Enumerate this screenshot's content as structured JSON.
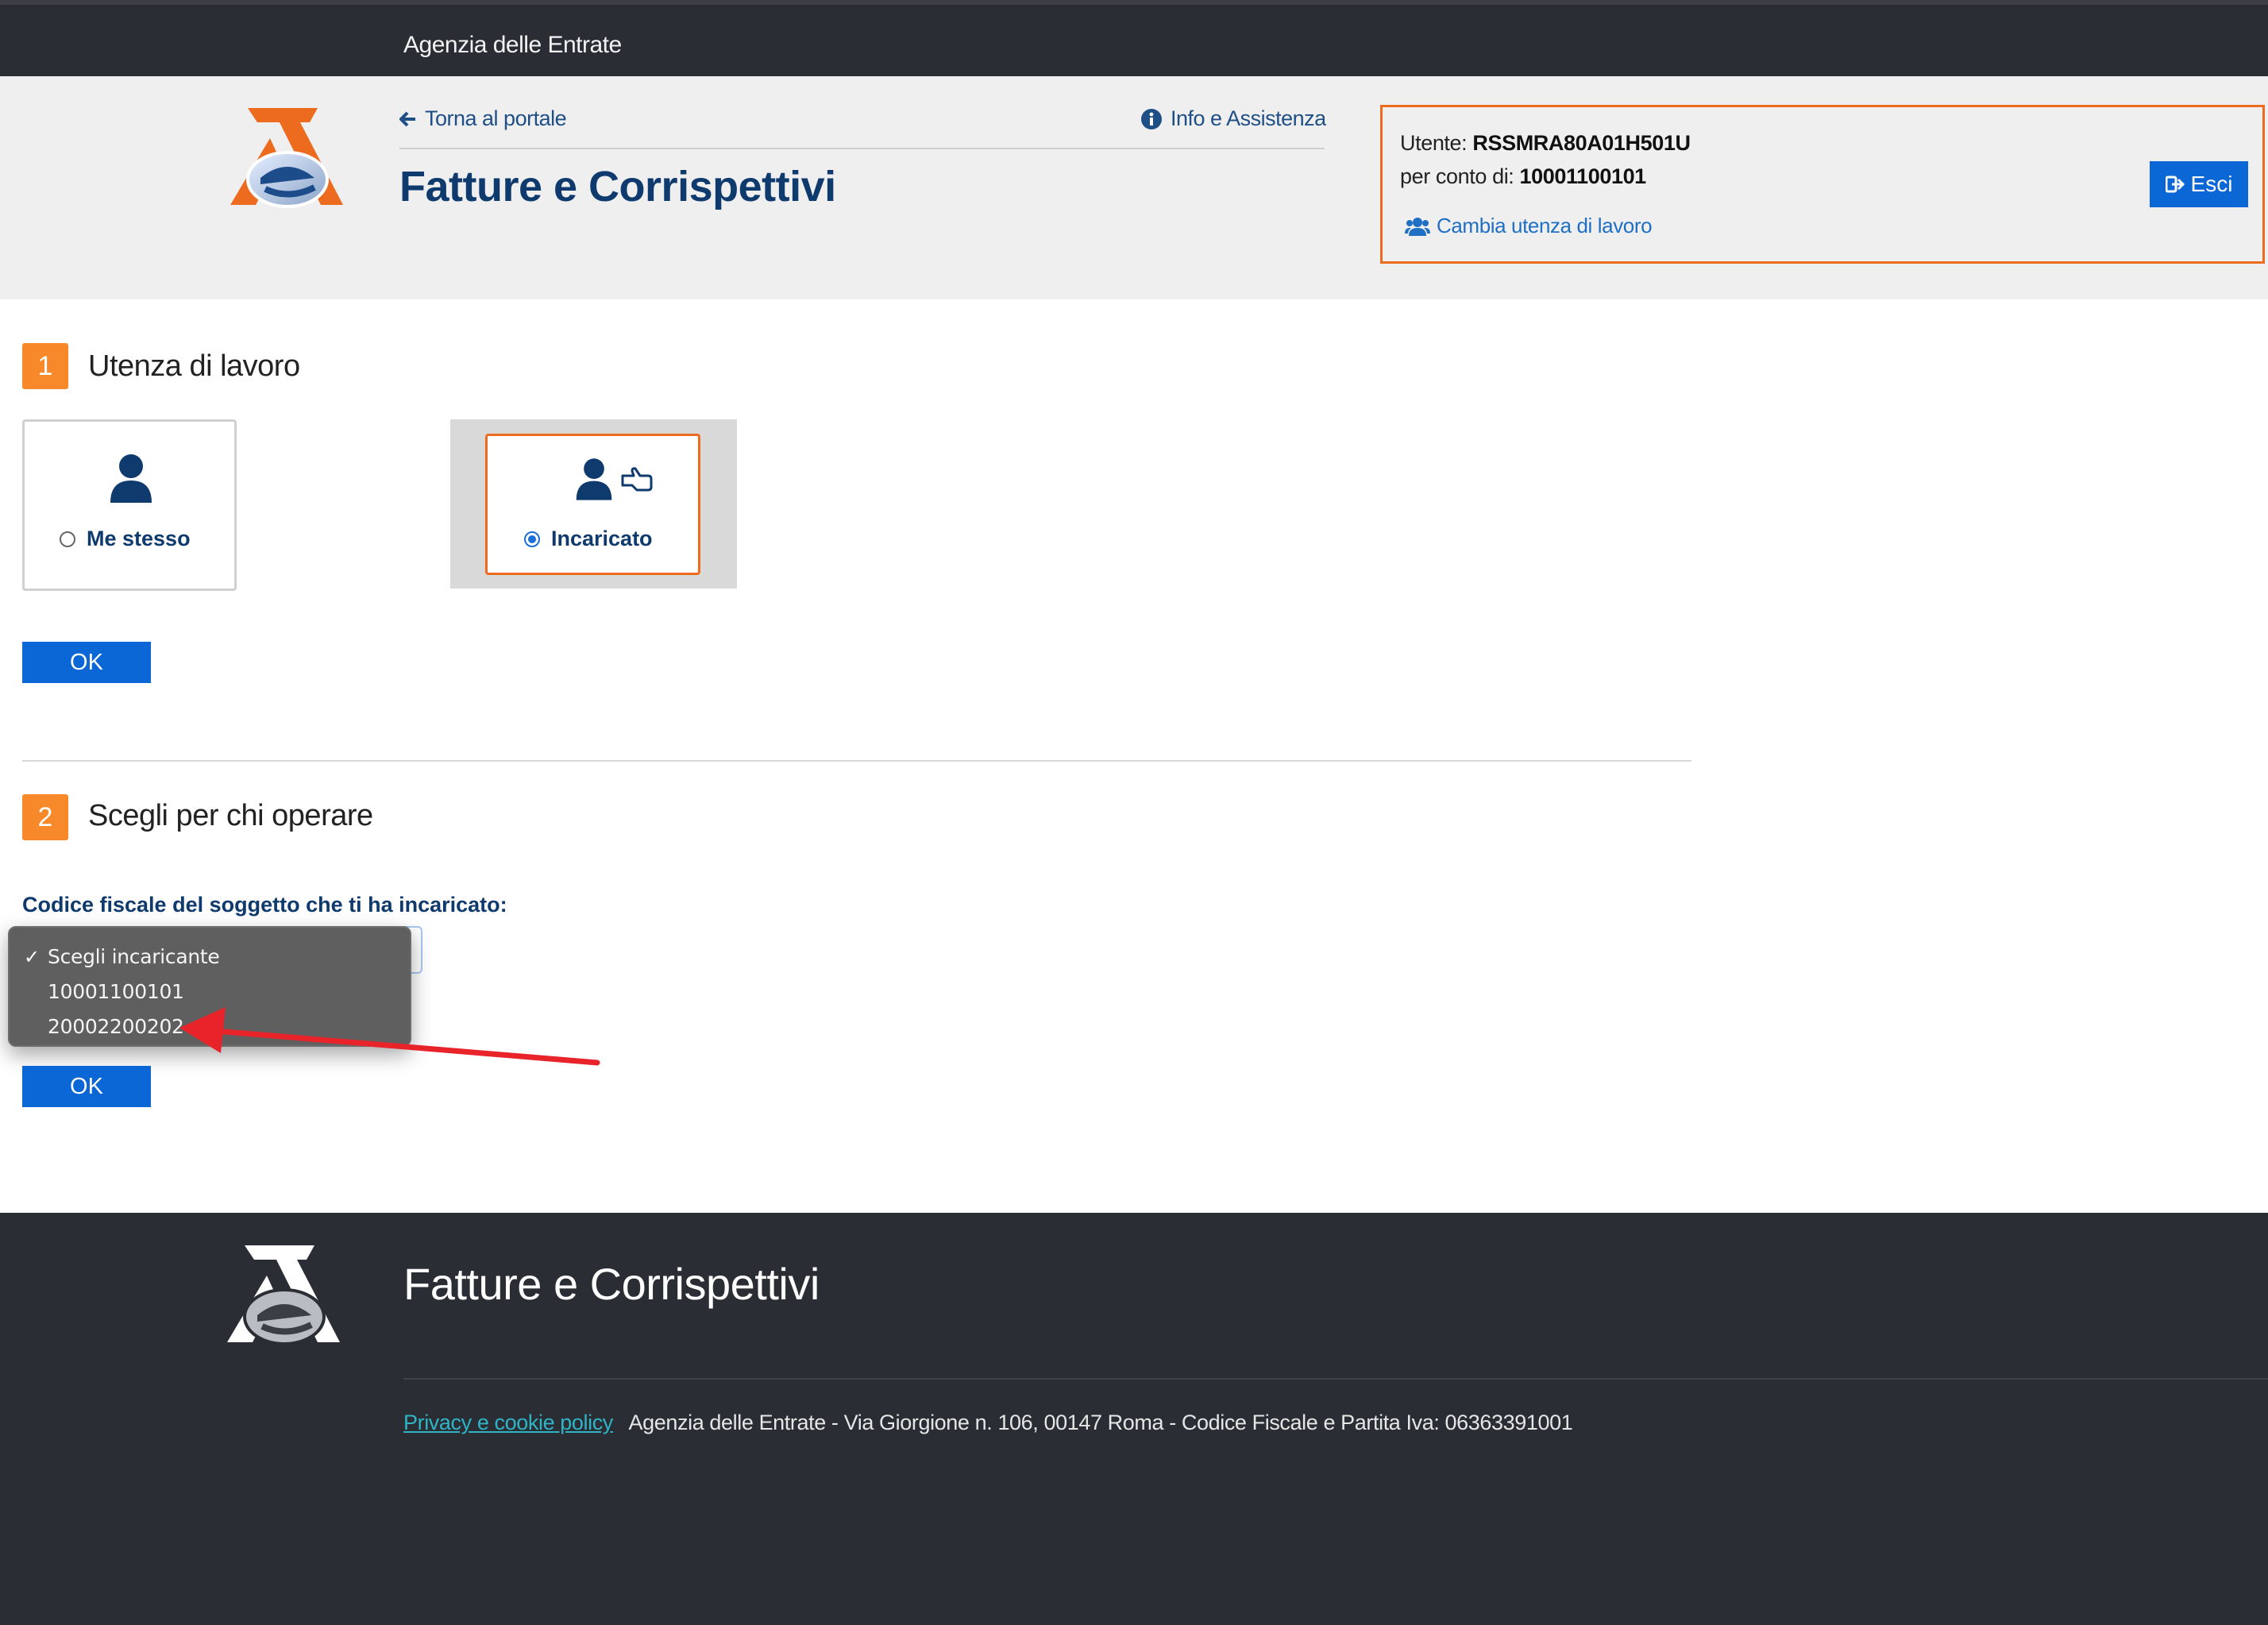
{
  "topbar": {
    "agency": "Agenzia delle Entrate"
  },
  "header": {
    "back_link": "Torna al portale",
    "info_link": "Info e Assistenza",
    "title": "Fatture e Corrispettivi"
  },
  "user_box": {
    "user_label": "Utente:",
    "user_value": "RSSMRA80A01H501U",
    "on_behalf_label": "per conto di:",
    "on_behalf_value": "10001100101",
    "change_link": "Cambia utenza di lavoro",
    "logout": "Esci"
  },
  "step1": {
    "number": "1",
    "title": "Utenza di lavoro",
    "option_me": "Me stesso",
    "option_incaricato": "Incaricato",
    "selected": "Incaricato",
    "ok": "OK"
  },
  "step2": {
    "number": "2",
    "title": "Scegli per chi operare",
    "field_label": "Codice fiscale del soggetto che ti ha incaricato:",
    "options": [
      "Scegli incaricante",
      "10001100101",
      "20002200202"
    ],
    "selected": "Scegli incaricante",
    "ok": "OK"
  },
  "footer": {
    "title": "Fatture e Corrispettivi",
    "privacy": "Privacy e cookie policy",
    "address": "Agenzia delle Entrate - Via Giorgione n. 106, 00147 Roma - Codice Fiscale e Partita Iva: 06363391001"
  },
  "colors": {
    "brand_blue": "#0f3a6e",
    "button_blue": "#0b66d6",
    "accent_orange": "#ec6b1e",
    "step_orange": "#f7892b",
    "dark_bar": "#2a2d33",
    "annotation_red": "#e8232a"
  }
}
